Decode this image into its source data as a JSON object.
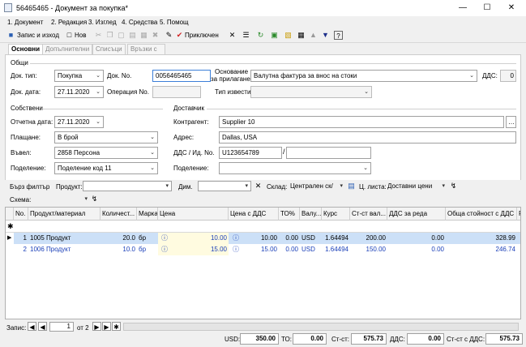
{
  "window": {
    "title": "56465465 - Документ за покупка*"
  },
  "menu": [
    "1. Документ",
    "2. Редакция",
    "3. Изглед",
    "4. Средства",
    "5. Помощ"
  ],
  "toolbar": {
    "save_exit": "Запис и изход",
    "new": "Нов",
    "status": "Приключен"
  },
  "tabs": [
    "Основни",
    "Допълнителни",
    "Списъци",
    "Връзки с документи"
  ],
  "general": {
    "heading": "Общи",
    "doc_type_label": "Док. тип:",
    "doc_type": "Покупка",
    "doc_no_label": "Док. No.",
    "doc_no": "0056465465",
    "basis_label_1": "Основание",
    "basis_label_2": "за прилагане:",
    "basis": "Валутна фактура за внос на стоки",
    "vat_label": "ДДС:",
    "vat": "0",
    "doc_date_label": "Док. дата:",
    "doc_date": "27.11.2020",
    "operation_label": "Операция No.",
    "operation": "",
    "notice_label": "Тип известие:",
    "notice": ""
  },
  "own": {
    "heading": "Собствени",
    "report_date_label": "Отчетна дата:",
    "report_date": "27.11.2020",
    "payment_label": "Плащане:",
    "payment": "В брой",
    "entered_label": "Въвел:",
    "entered": "2858 Персона",
    "division_label": "Поделение:",
    "division": "Поделение код 11"
  },
  "supplier": {
    "heading": "Доставчик",
    "contractor_label": "Контрагент:",
    "contractor": "Supplier 10",
    "address_label": "Адрес:",
    "address": "Dallas, USA",
    "vat_id_label": "ДДС / Ид. No.",
    "vat_id": "U123654789",
    "id_no": "",
    "division_label": "Поделение:",
    "division": ""
  },
  "filters": {
    "quick_filter": "Бърз филтър",
    "product_label": "Продукт:",
    "product": "",
    "dim_label": "Дим.",
    "dim": "",
    "warehouse_label": "Склад:",
    "warehouse": "Централен ск/",
    "price_list_label": "Ц. листа:",
    "price_list": "Доставни цени",
    "schema_label": "Схема:",
    "schema": ""
  },
  "grid": {
    "headers": [
      "No.",
      "Продукт/материал",
      "Количест...",
      "Марка",
      "Цена",
      "Цена с ДДС",
      "ТО%",
      "Валу...",
      "Курс",
      "Ст-ст вал...",
      "ДДС за реда",
      "Обща стойност с ДДС",
      "Р"
    ],
    "rows": [
      {
        "no": "1",
        "product": "1005 Продукт",
        "qty": "20.0",
        "unit": "бр",
        "price": "10.00",
        "price_vat": "10.00",
        "to": "0.00",
        "cur": "USD",
        "rate": "1.64494",
        "cost_cur": "200.00",
        "vat_row": "0.00",
        "total": "328.99"
      },
      {
        "no": "2",
        "product": "1006 Продукт",
        "qty": "10.0",
        "unit": "бр",
        "price": "15.00",
        "price_vat": "15.00",
        "to": "0.00",
        "cur": "USD",
        "rate": "1.64494",
        "cost_cur": "150.00",
        "vat_row": "0.00",
        "total": "246.74"
      }
    ]
  },
  "nav": {
    "record_label": "Запис:",
    "current": "1",
    "of": "от 2"
  },
  "totals": {
    "usd_label": "USD:",
    "usd": "350.00",
    "to_label": "ТО:",
    "to": "0.00",
    "cost_label": "Ст-ст:",
    "cost": "575.73",
    "vat_label": "ДДС:",
    "vat": "0.00",
    "cost_vat_label": "Ст-ст с ДДС:",
    "cost_vat": "575.73"
  },
  "colors": {
    "selected_row": "#cce0f7",
    "second_row_text": "#1a3fb8",
    "yellow_cell": "#fffbe0"
  }
}
